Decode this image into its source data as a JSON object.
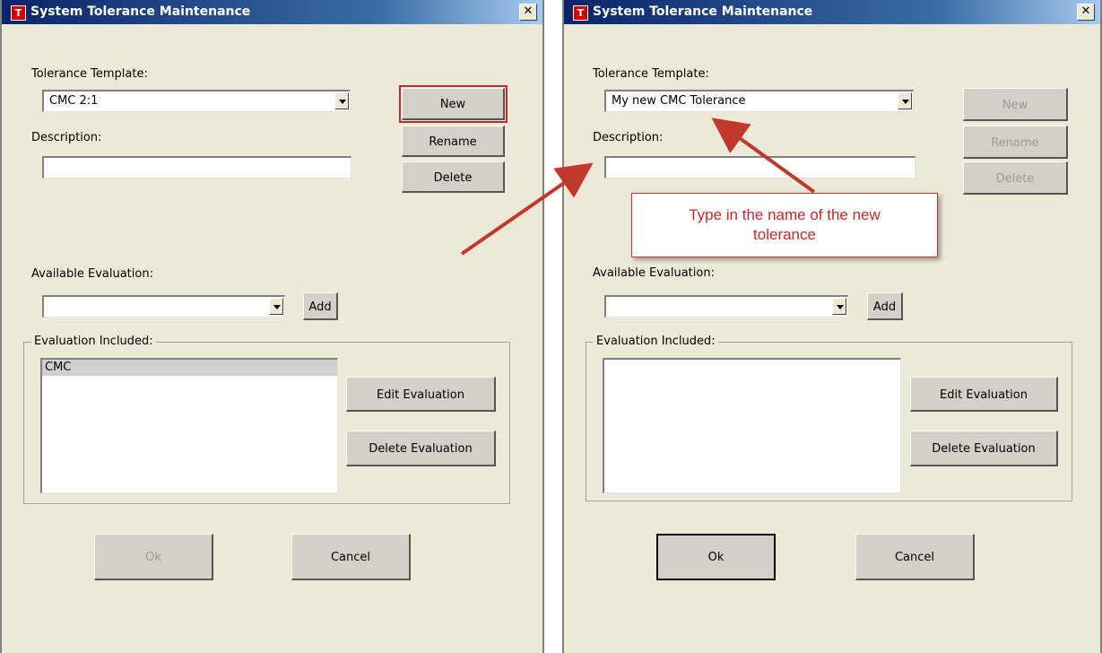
{
  "left_window": {
    "title": "System Tolerance Maintenance",
    "close_glyph": "✕",
    "app_icon_letter": "T",
    "tolerance_template_label": "Tolerance Template:",
    "tolerance_template_value": "CMC 2:1",
    "description_label": "Description:",
    "description_value": "",
    "new_label": "New",
    "rename_label": "Rename",
    "delete_label": "Delete",
    "available_evaluation_label": "Available Evaluation:",
    "available_evaluation_value": "",
    "add_label": "Add",
    "evaluation_included_label": "Evaluation Included:",
    "evaluation_items": [
      "CMC"
    ],
    "edit_evaluation_label": "Edit Evaluation",
    "delete_evaluation_label": "Delete Evaluation",
    "ok_label": "Ok",
    "cancel_label": "Cancel"
  },
  "right_window": {
    "title": "System Tolerance Maintenance",
    "close_glyph": "✕",
    "app_icon_letter": "T",
    "tolerance_template_label": "Tolerance Template:",
    "tolerance_template_value": "My new CMC Tolerance",
    "description_label": "Description:",
    "description_value": "",
    "new_label": "New",
    "rename_label": "Rename",
    "delete_label": "Delete",
    "available_evaluation_label": "Available Evaluation:",
    "available_evaluation_value": "",
    "add_label": "Add",
    "evaluation_included_label": "Evaluation Included:",
    "evaluation_items": [],
    "edit_evaluation_label": "Edit Evaluation",
    "delete_evaluation_label": "Delete Evaluation",
    "ok_label": "Ok",
    "cancel_label": "Cancel"
  },
  "annotation": {
    "callout_line1": "Type in the name of the new",
    "callout_line2": "tolerance",
    "color": "#c0292e"
  }
}
